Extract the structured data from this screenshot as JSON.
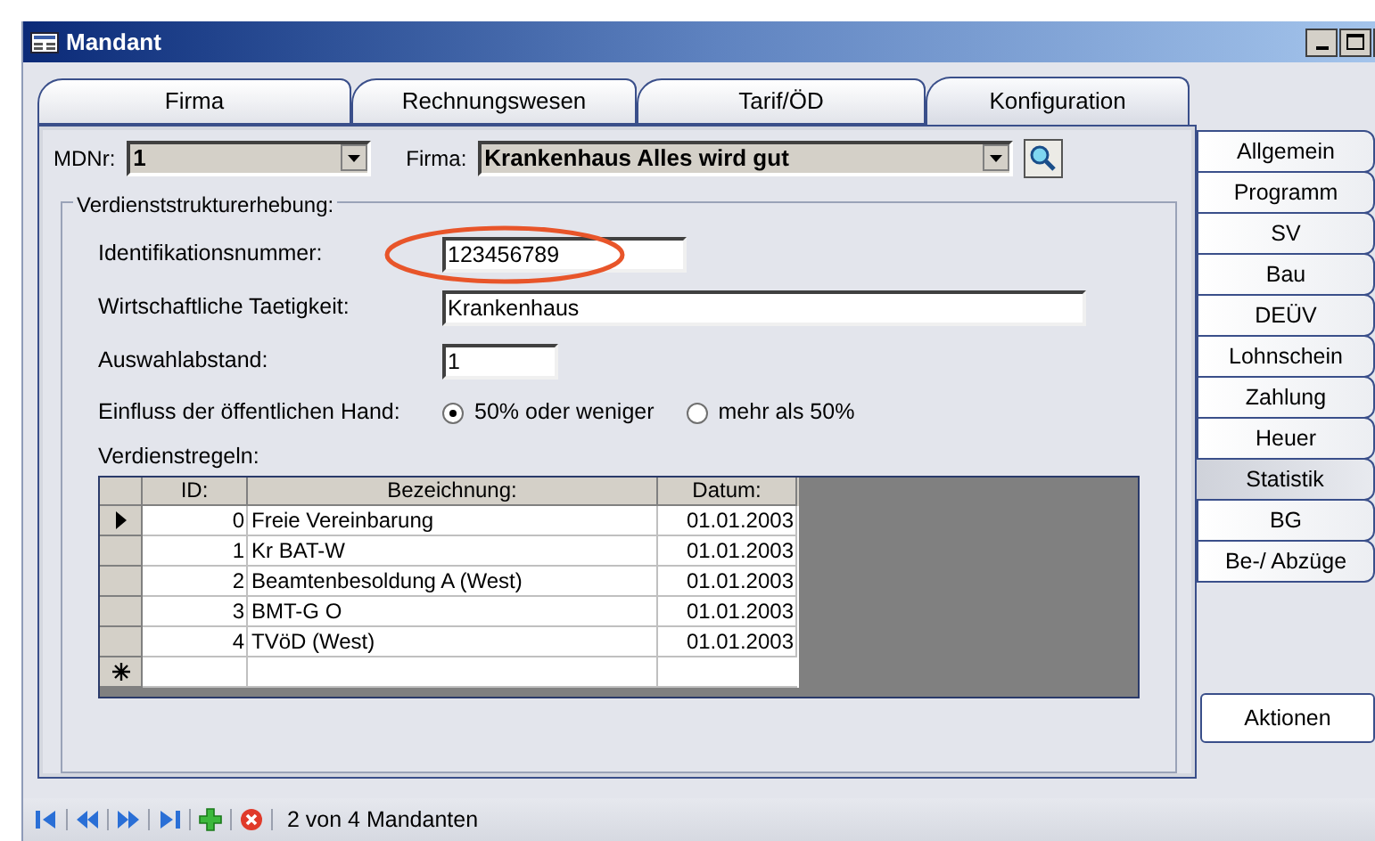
{
  "window": {
    "title": "Mandant"
  },
  "main_tabs": [
    {
      "label": "Firma",
      "selected": false
    },
    {
      "label": "Rechnungswesen",
      "selected": false
    },
    {
      "label": "Tarif/ÖD",
      "selected": false
    },
    {
      "label": "Konfiguration",
      "selected": true
    }
  ],
  "mdnr": {
    "label": "MDNr:",
    "value": "1"
  },
  "firma": {
    "label": "Firma:",
    "value": "Krankenhaus Alles wird gut"
  },
  "group": {
    "title": "Verdienststrukturerhebung:",
    "fields": [
      {
        "label": "Identifikationsnummer:",
        "value": "123456789",
        "highlighted": true
      },
      {
        "label": "Wirtschaftliche Taetigkeit:",
        "value": "Krankenhaus",
        "highlighted": false
      },
      {
        "label": "Auswahlabstand:",
        "value": "1",
        "highlighted": false
      }
    ],
    "radio": {
      "label": "Einfluss der öffentlichen Hand:",
      "options": [
        {
          "label": "50% oder weniger",
          "selected": true
        },
        {
          "label": "mehr als 50%",
          "selected": false
        }
      ]
    },
    "grid": {
      "label": "Verdienstregeln:",
      "columns": [
        "ID:",
        "Bezeichnung:",
        "Datum:"
      ],
      "new_row": true,
      "rows": [
        {
          "id": "0",
          "name": "Freie Vereinbarung",
          "date": "01.01.2003",
          "current": true
        },
        {
          "id": "1",
          "name": "Kr BAT-W",
          "date": "01.01.2003",
          "current": false
        },
        {
          "id": "2",
          "name": "Beamtenbesoldung A (West)",
          "date": "01.01.2003",
          "current": false
        },
        {
          "id": "3",
          "name": "BMT-G O",
          "date": "01.01.2003",
          "current": false
        },
        {
          "id": "4",
          "name": "TVöD (West)",
          "date": "01.01.2003",
          "current": false
        }
      ]
    }
  },
  "side_tabs": [
    {
      "label": "Allgemein",
      "selected": false
    },
    {
      "label": "Programm",
      "selected": false
    },
    {
      "label": "SV",
      "selected": false
    },
    {
      "label": "Bau",
      "selected": false
    },
    {
      "label": "DEÜV",
      "selected": false
    },
    {
      "label": "Lohnschein",
      "selected": false
    },
    {
      "label": "Zahlung",
      "selected": false
    },
    {
      "label": "Heuer",
      "selected": false
    },
    {
      "label": "Statistik",
      "selected": true
    },
    {
      "label": "BG",
      "selected": false
    },
    {
      "label": "Be-/ Abzüge",
      "selected": false
    }
  ],
  "action_button": "Aktionen",
  "status": {
    "record": "2 von 4 Mandanten"
  }
}
